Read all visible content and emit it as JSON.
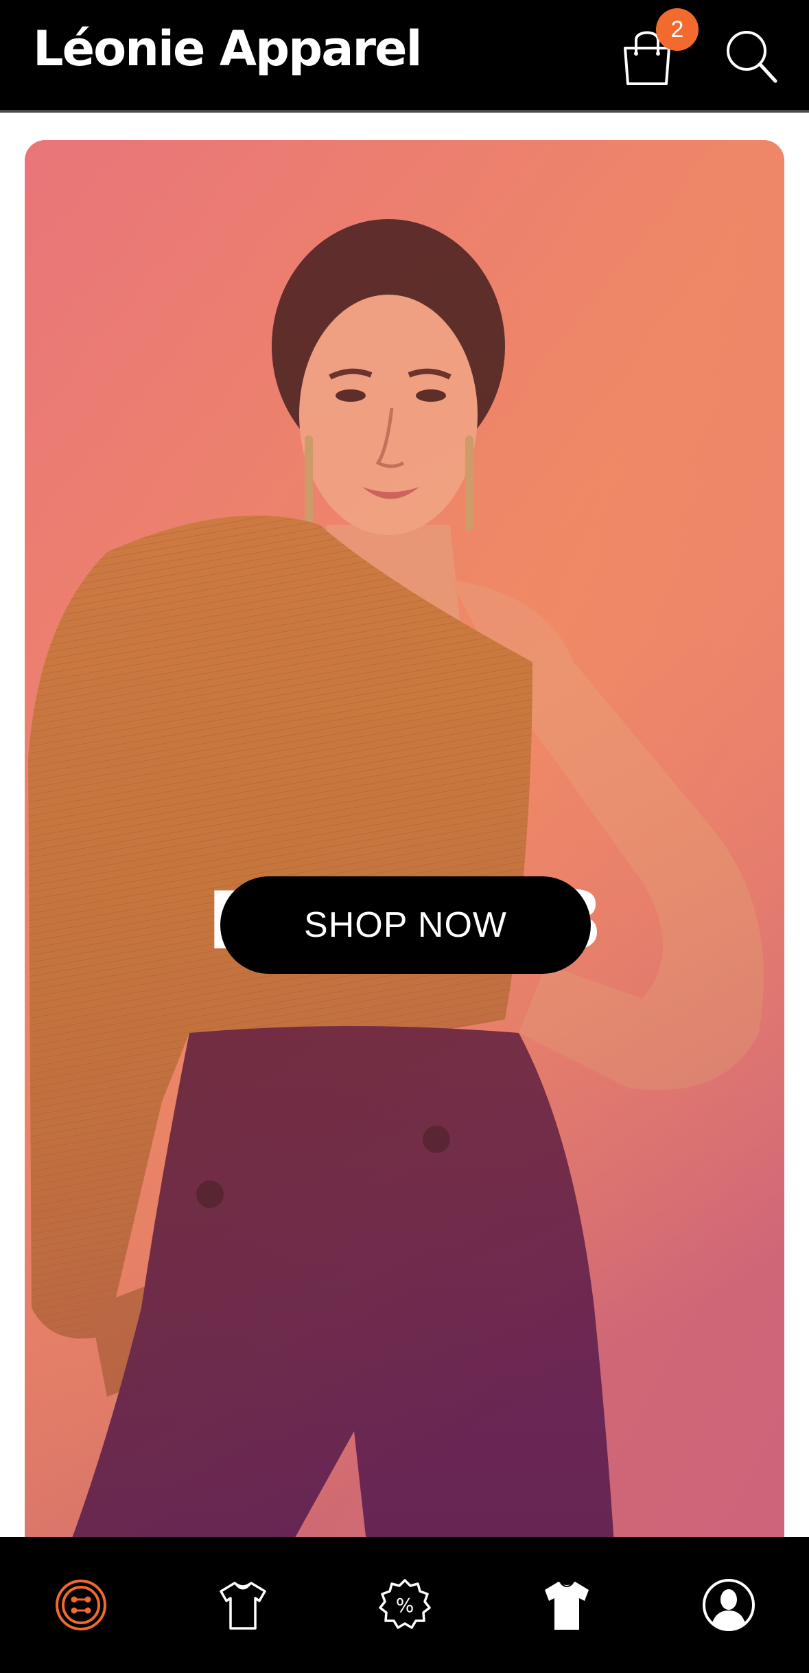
{
  "header": {
    "brand": "Léonie Apparel",
    "cart_count": "2",
    "cart_icon": "shopping-bag-icon",
    "search_icon": "search-icon"
  },
  "hero": {
    "title": "Fall 2023",
    "cta_label": "SHOP NOW"
  },
  "bottom_nav": {
    "items": [
      {
        "icon": "button-icon",
        "active": true
      },
      {
        "icon": "tshirt-outline-icon",
        "active": false
      },
      {
        "icon": "discount-badge-icon",
        "active": false
      },
      {
        "icon": "tshirt-filled-icon",
        "active": false
      },
      {
        "icon": "user-profile-icon",
        "active": false
      }
    ]
  },
  "colors": {
    "accent": "#f26a2e",
    "header_bg": "#000000",
    "nav_bg": "#000000"
  }
}
